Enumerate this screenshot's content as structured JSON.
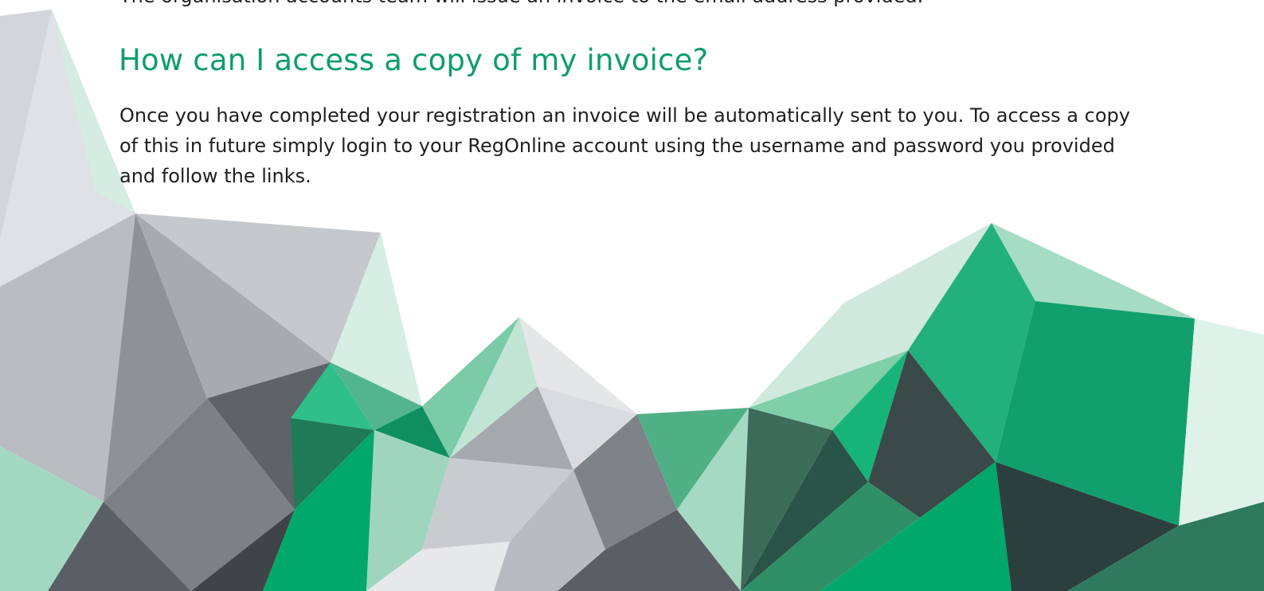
{
  "faq": {
    "cutoff_text": "The organisation accounts team will issue an invoice to the email address provided.",
    "question": "How can I access a copy of my invoice?",
    "answer": "Once you have completed your registration an invoice will be automatically sent to you. To access a copy of this in future simply login to your RegOnline account using the username and password you provided and follow the links."
  },
  "colors": {
    "heading": "#0f9d6b",
    "body_text": "#1f1f1f",
    "accent_green": "#00a86b",
    "gray": "#7c8087"
  }
}
